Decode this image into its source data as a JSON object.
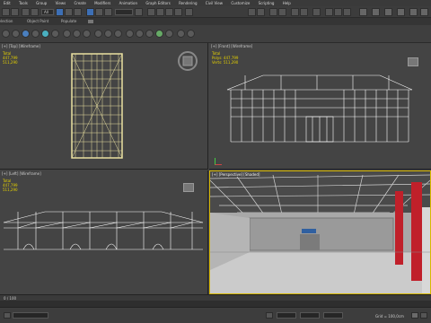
{
  "menu": [
    "Edit",
    "Tools",
    "Group",
    "Views",
    "Create",
    "Modifiers",
    "Animation",
    "Graph Editors",
    "Rendering",
    "Civil View",
    "Customize",
    "Scripting",
    "Help"
  ],
  "ribbon_tabs": [
    "Selection",
    "Object Paint",
    "Populate"
  ],
  "toolbar": {
    "view_dropdown": "All"
  },
  "viewports": {
    "top": {
      "label": "[+] [Top] [Wireframe]"
    },
    "front": {
      "label": "[+] [Front] [Wireframe]"
    },
    "left": {
      "label": "[+] [Left] [Wireframe]"
    },
    "perspective": {
      "label": "[+] [Perspective] [Shaded]"
    }
  },
  "stats": {
    "total_label": "Total",
    "polys_label": "Polys:",
    "verts_label": "Verts:",
    "polys": "447,799",
    "verts": "511,290"
  },
  "timeline": {
    "frame": "0 / 100"
  },
  "status": {
    "grid": "Grid = 100,0cm"
  },
  "colors": {
    "accent": "#3d6fb5",
    "active_border": "#d8b800",
    "wire_white": "#ffffff",
    "wire_yellow": "#e9e0a0",
    "stat_yellow": "#e4d000",
    "column_red": "#c0202a"
  }
}
